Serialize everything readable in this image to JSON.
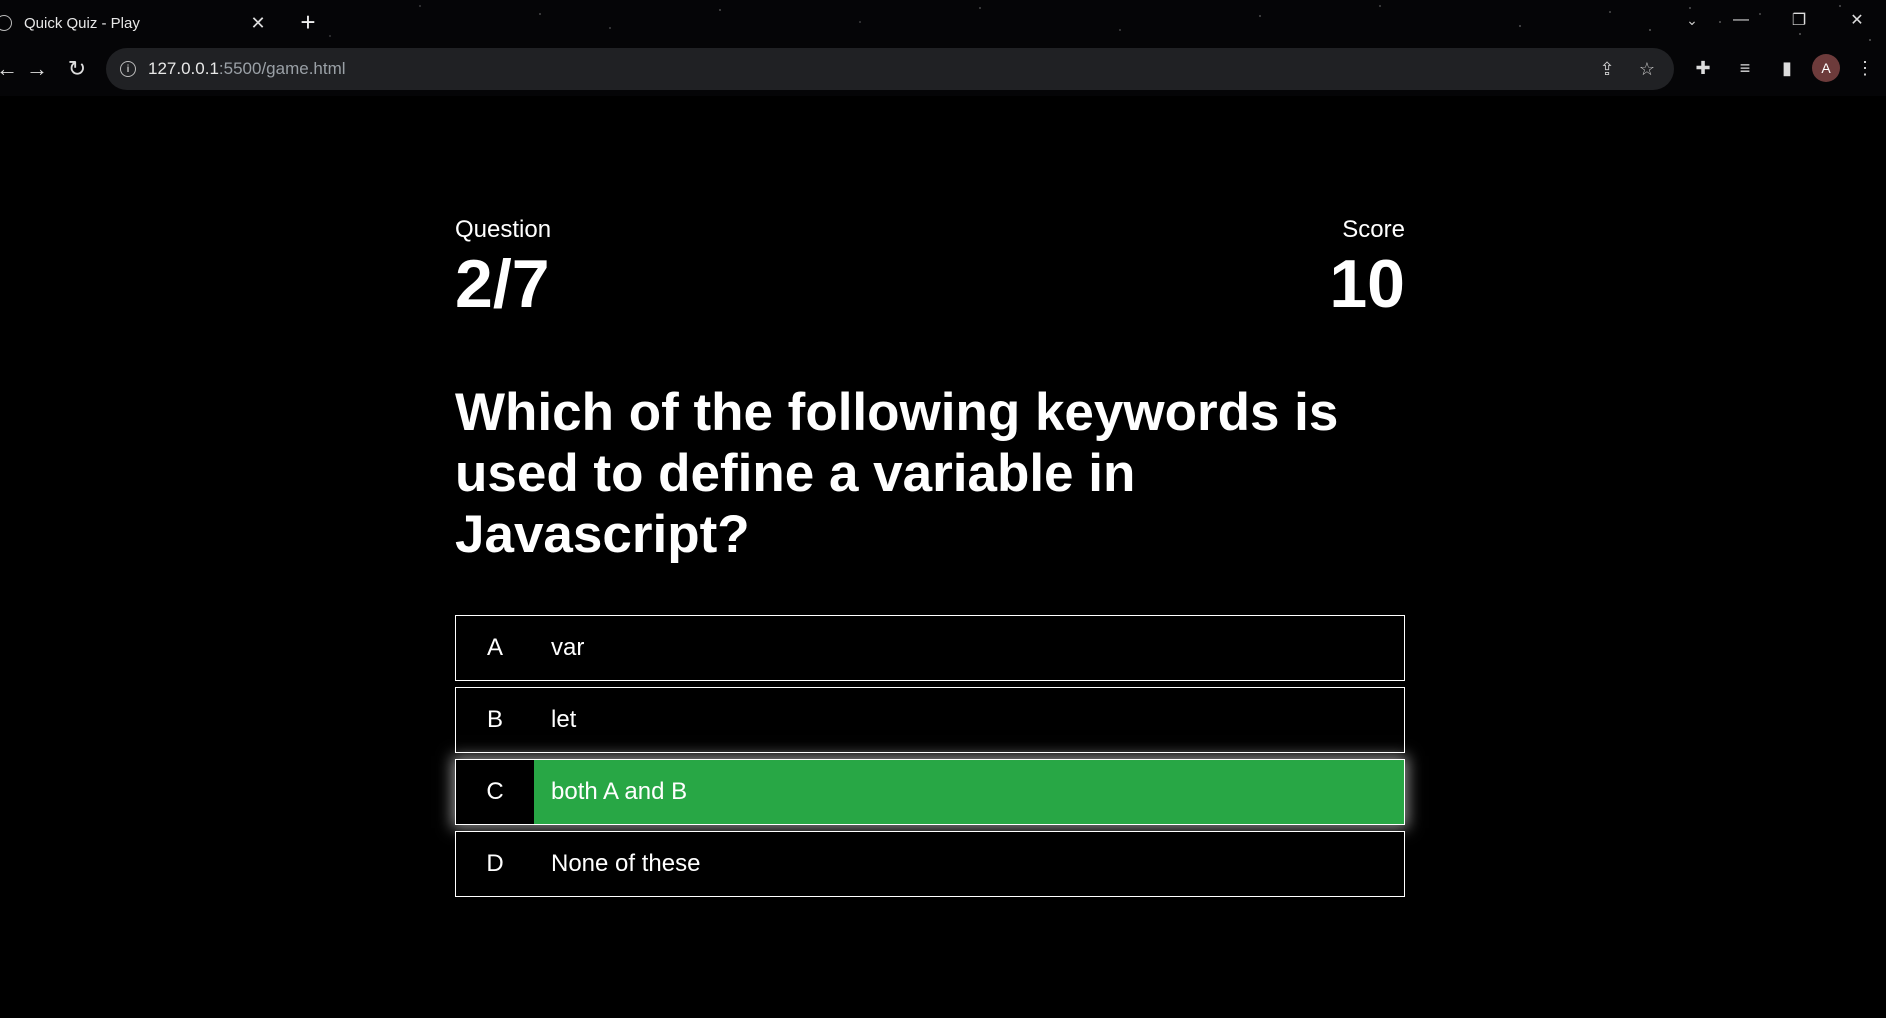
{
  "browser": {
    "tab": {
      "title": "Quick Quiz - Play",
      "close_glyph": "✕"
    },
    "new_tab_glyph": "+",
    "address": {
      "host": "127.0.0.1",
      "path": ":5500/game.html"
    },
    "avatar_letter": "A"
  },
  "hud": {
    "question_label": "Question",
    "question_progress": "2/7",
    "score_label": "Score",
    "score_value": "10"
  },
  "question": "Which of the following keywords is used to define a variable in Javascript?",
  "choices": [
    {
      "prefix": "A",
      "text": "var",
      "state": "default"
    },
    {
      "prefix": "B",
      "text": "let",
      "state": "default"
    },
    {
      "prefix": "C",
      "text": "both A and B",
      "state": "correct"
    },
    {
      "prefix": "D",
      "text": "None of these",
      "state": "default"
    }
  ],
  "colors": {
    "correct": "#28a745",
    "background": "#000000",
    "text": "#ffffff"
  },
  "icons": [
    "globe-icon",
    "close-icon",
    "plus-icon",
    "back-icon",
    "forward-icon",
    "reload-icon",
    "info-icon",
    "share-icon",
    "star-icon",
    "puzzle-icon",
    "reading-list-icon",
    "side-panel-icon",
    "menu-icon",
    "minimize-icon",
    "restore-icon",
    "window-close-icon",
    "tab-search-icon"
  ]
}
